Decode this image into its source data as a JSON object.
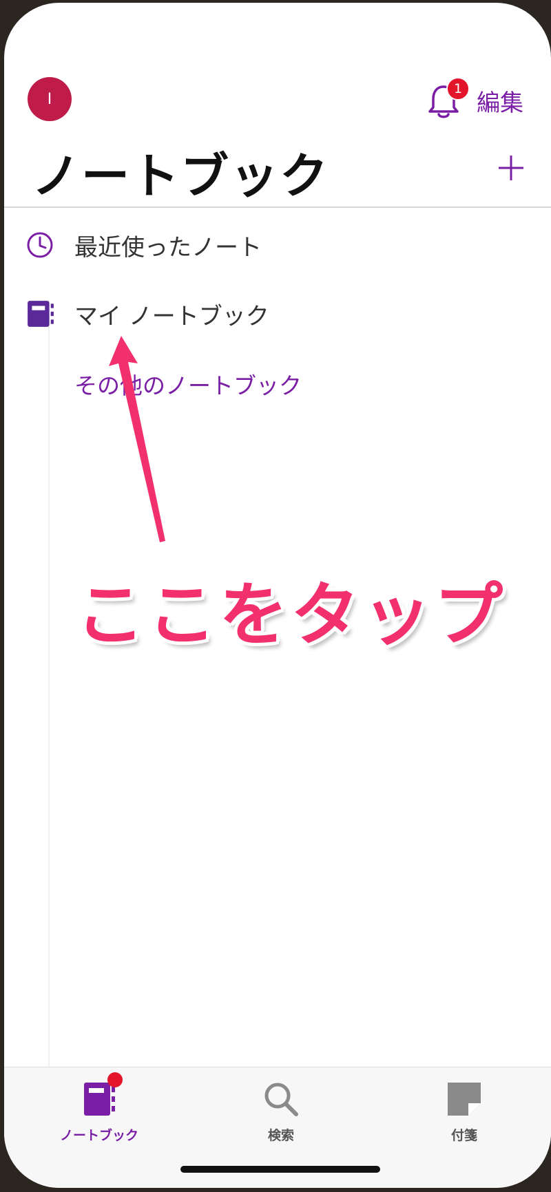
{
  "header": {
    "avatar_initial": "I",
    "notification_count": "1",
    "edit_label": "編集",
    "title": "ノートブック"
  },
  "list": {
    "items": [
      {
        "label": "最近使ったノート",
        "icon": "clock-icon"
      },
      {
        "label": "マイ ノートブック",
        "icon": "notebook-icon"
      }
    ],
    "other_link": "その他のノートブック"
  },
  "annotation": {
    "text": "ここをタップ",
    "color": "#f2306e"
  },
  "tabbar": {
    "tabs": [
      {
        "label": "ノートブック",
        "icon": "notebook-icon",
        "active": true
      },
      {
        "label": "検索",
        "icon": "search-icon",
        "active": false
      },
      {
        "label": "付箋",
        "icon": "sticky-note-icon",
        "active": false
      }
    ]
  },
  "colors": {
    "accent": "#7a1fa5",
    "avatar": "#c01c4a",
    "badge": "#e3152b"
  }
}
